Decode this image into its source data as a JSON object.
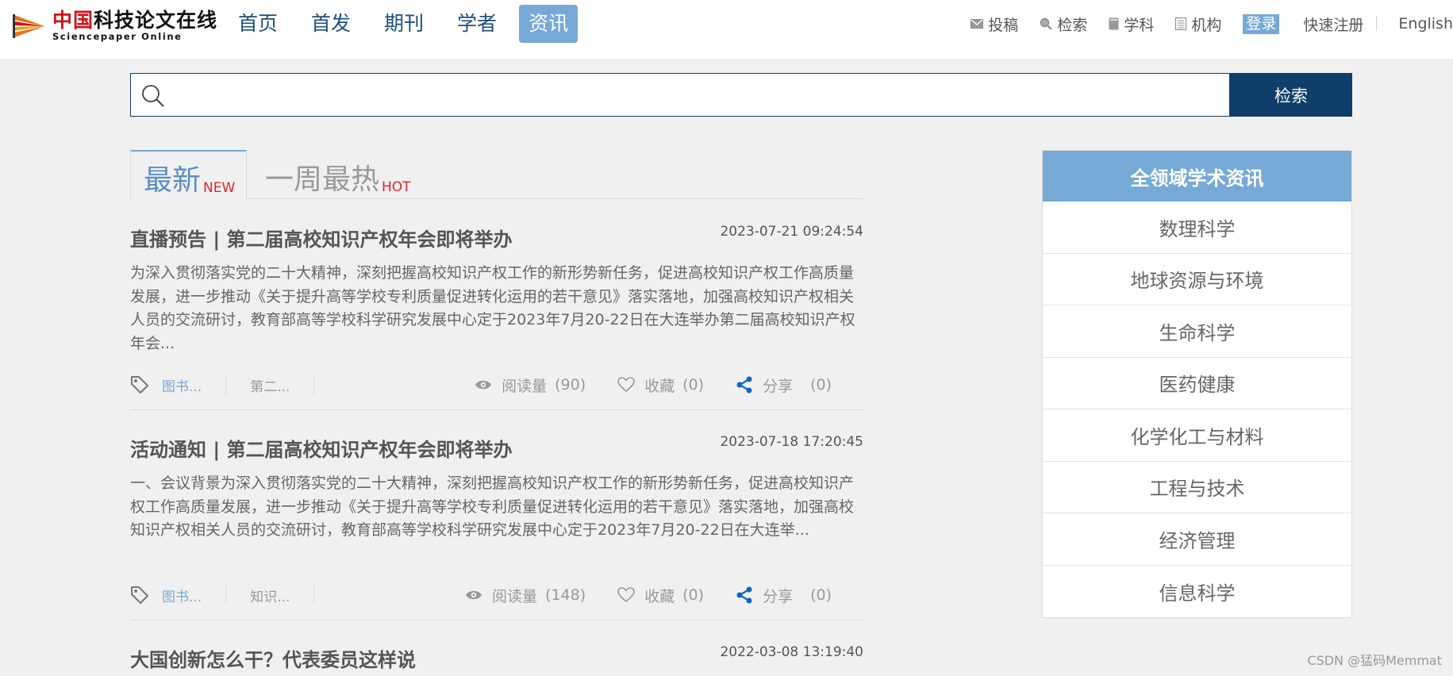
{
  "header": {
    "logo": {
      "cn_red": "中国",
      "cn_black": "科技论文在线",
      "en": "Sciencepaper Online"
    },
    "main_nav": [
      {
        "label": "首页",
        "active": false
      },
      {
        "label": "首发",
        "active": false
      },
      {
        "label": "期刊",
        "active": false
      },
      {
        "label": "学者",
        "active": false
      },
      {
        "label": "资讯",
        "active": true
      }
    ],
    "util_nav": {
      "submit": "投稿",
      "search": "检索",
      "subject": "学科",
      "institution": "机构",
      "login": "登录",
      "register": "快速注册",
      "language": "English"
    }
  },
  "search": {
    "value": "",
    "placeholder": "",
    "button_label": "检索"
  },
  "tabs": {
    "latest": {
      "label": "最新",
      "badge": "NEW"
    },
    "hot": {
      "label": "一周最热",
      "badge": "HOT"
    }
  },
  "news": [
    {
      "title": "直播预告 | 第二届高校知识产权年会即将举办",
      "date": "2023-07-21 09:24:54",
      "summary": "为深入贯彻落实党的二十大精神，深刻把握高校知识产权工作的新形势新任务，促进高校知识产权工作高质量发展，进一步推动《关于提升高等学校专利质量促进转化运用的若干意见》落实落地，加强高校知识产权相关人员的交流研讨，教育部高等学校科学研究发展中心定于2023年7月20-22日在大连举办第二届高校知识产权年会...",
      "tag1": "图书...",
      "tag2": "第二...",
      "reads_label": "阅读量",
      "reads": "(90)",
      "fav_label": "收藏",
      "favs": "(0)",
      "share_label": "分享",
      "shares": "(0)"
    },
    {
      "title": "活动通知 | 第二届高校知识产权年会即将举办",
      "date": "2023-07-18 17:20:45",
      "summary": " 一、会议背景为深入贯彻落实党的二十大精神，深刻把握高校知识产权工作的新形势新任务，促进高校知识产权工作高质量发展，进一步推动《关于提升高等学校专利质量促进转化运用的若干意见》落实落地，加强高校知识产权相关人员的交流研讨，教育部高等学校科学研究发展中心定于2023年7月20-22日在大连举...",
      "tag1": "图书...",
      "tag2": "知识...",
      "reads_label": "阅读量",
      "reads": "(148)",
      "fav_label": "收藏",
      "favs": "(0)",
      "share_label": "分享",
      "shares": "(0)"
    },
    {
      "title": "大国创新怎么干？代表委员这样说",
      "date": "2022-03-08 13:19:40"
    }
  ],
  "sidebar": {
    "title": "全领域学术资讯",
    "items": [
      "数理科学",
      "地球资源与环境",
      "生命科学",
      "医药健康",
      "化学化工与材料",
      "工程与技术",
      "经济管理",
      "信息科学"
    ]
  },
  "watermark": "CSDN @猛码Memmat",
  "colors": {
    "accent": "#76a9d6",
    "dark_blue": "#0e3e69",
    "nav_text": "#1d4f7c",
    "logo_red": "#d0121b",
    "badge_red": "#e0242c",
    "share_blue": "#1565c0"
  }
}
